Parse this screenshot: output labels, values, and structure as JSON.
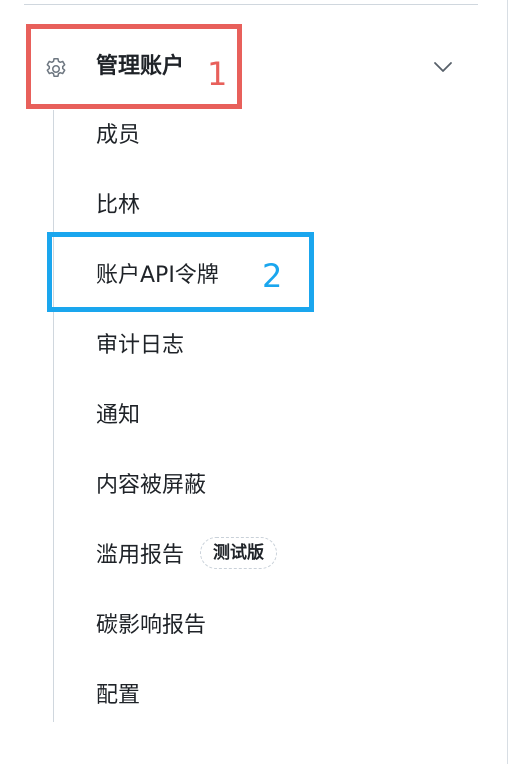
{
  "sidebar": {
    "section": {
      "label": "管理账户",
      "icon": "gear-icon",
      "expand_icon": "chevron-down-icon",
      "expanded": true
    },
    "items": [
      {
        "label": "成员"
      },
      {
        "label": "比林"
      },
      {
        "label": "账户API令牌"
      },
      {
        "label": "审计日志"
      },
      {
        "label": "通知"
      },
      {
        "label": "内容被屏蔽"
      },
      {
        "label": "滥用报告",
        "badge": "测试版"
      },
      {
        "label": "碳影响报告"
      },
      {
        "label": "配置"
      }
    ]
  },
  "annotations": [
    {
      "number": "1",
      "color": "#e8605b"
    },
    {
      "number": "2",
      "color": "#1aa6ee"
    }
  ]
}
